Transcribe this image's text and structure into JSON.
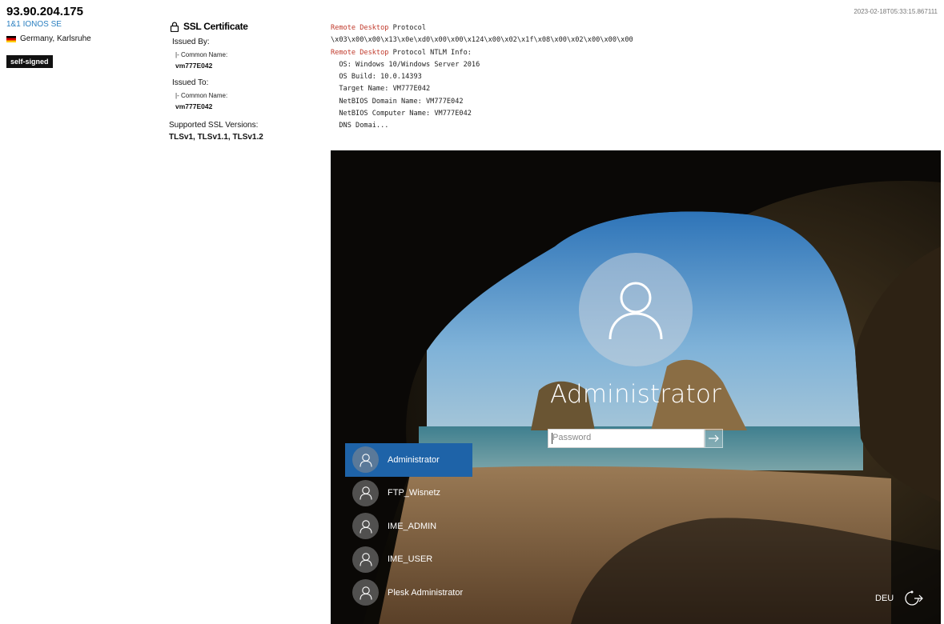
{
  "host": {
    "ip": "93.90.204.175",
    "org": "1&1 IONOS SE",
    "location": "Germany, Karlsruhe",
    "flag_icon": "flag-germany-icon",
    "badge": "self-signed",
    "timestamp": "2023-02-18T05:33:15.867111"
  },
  "ssl": {
    "title": "SSL Certificate",
    "issued_by_label": "Issued By:",
    "issued_by_cn_label": "|- Common Name:",
    "issued_by_cn": "vm777E042",
    "issued_to_label": "Issued To:",
    "issued_to_cn_label": "|- Common Name:",
    "issued_to_cn": "vm777E042",
    "versions_label": "Supported SSL Versions:",
    "versions": "TLSv1, TLSv1.1, TLSv1.2"
  },
  "banner": {
    "line1_kw": "Remote Desktop",
    "line1_rest": " Protocol",
    "line2": "\\x03\\x00\\x00\\x13\\x0e\\xd0\\x00\\x00\\x124\\x00\\x02\\x1f\\x08\\x00\\x02\\x00\\x00\\x00",
    "line3_kw": "Remote Desktop",
    "line3_rest": " Protocol NTLM Info:",
    "lines": [
      "  OS: Windows 10/Windows Server 2016",
      "  OS Build: 10.0.14393",
      "  Target Name: VM777E042",
      "  NetBIOS Domain Name: VM777E042",
      "  NetBIOS Computer Name: VM777E042",
      "  DNS Domai..."
    ]
  },
  "login": {
    "username": "Administrator",
    "password_placeholder": "Password",
    "language": "DEU",
    "users": [
      {
        "name": "Administrator",
        "active": true
      },
      {
        "name": "FTP_Wisnetz",
        "active": false
      },
      {
        "name": "IME_ADMIN",
        "active": false
      },
      {
        "name": "IME_USER",
        "active": false
      },
      {
        "name": "Plesk Administrator",
        "active": false
      }
    ]
  }
}
